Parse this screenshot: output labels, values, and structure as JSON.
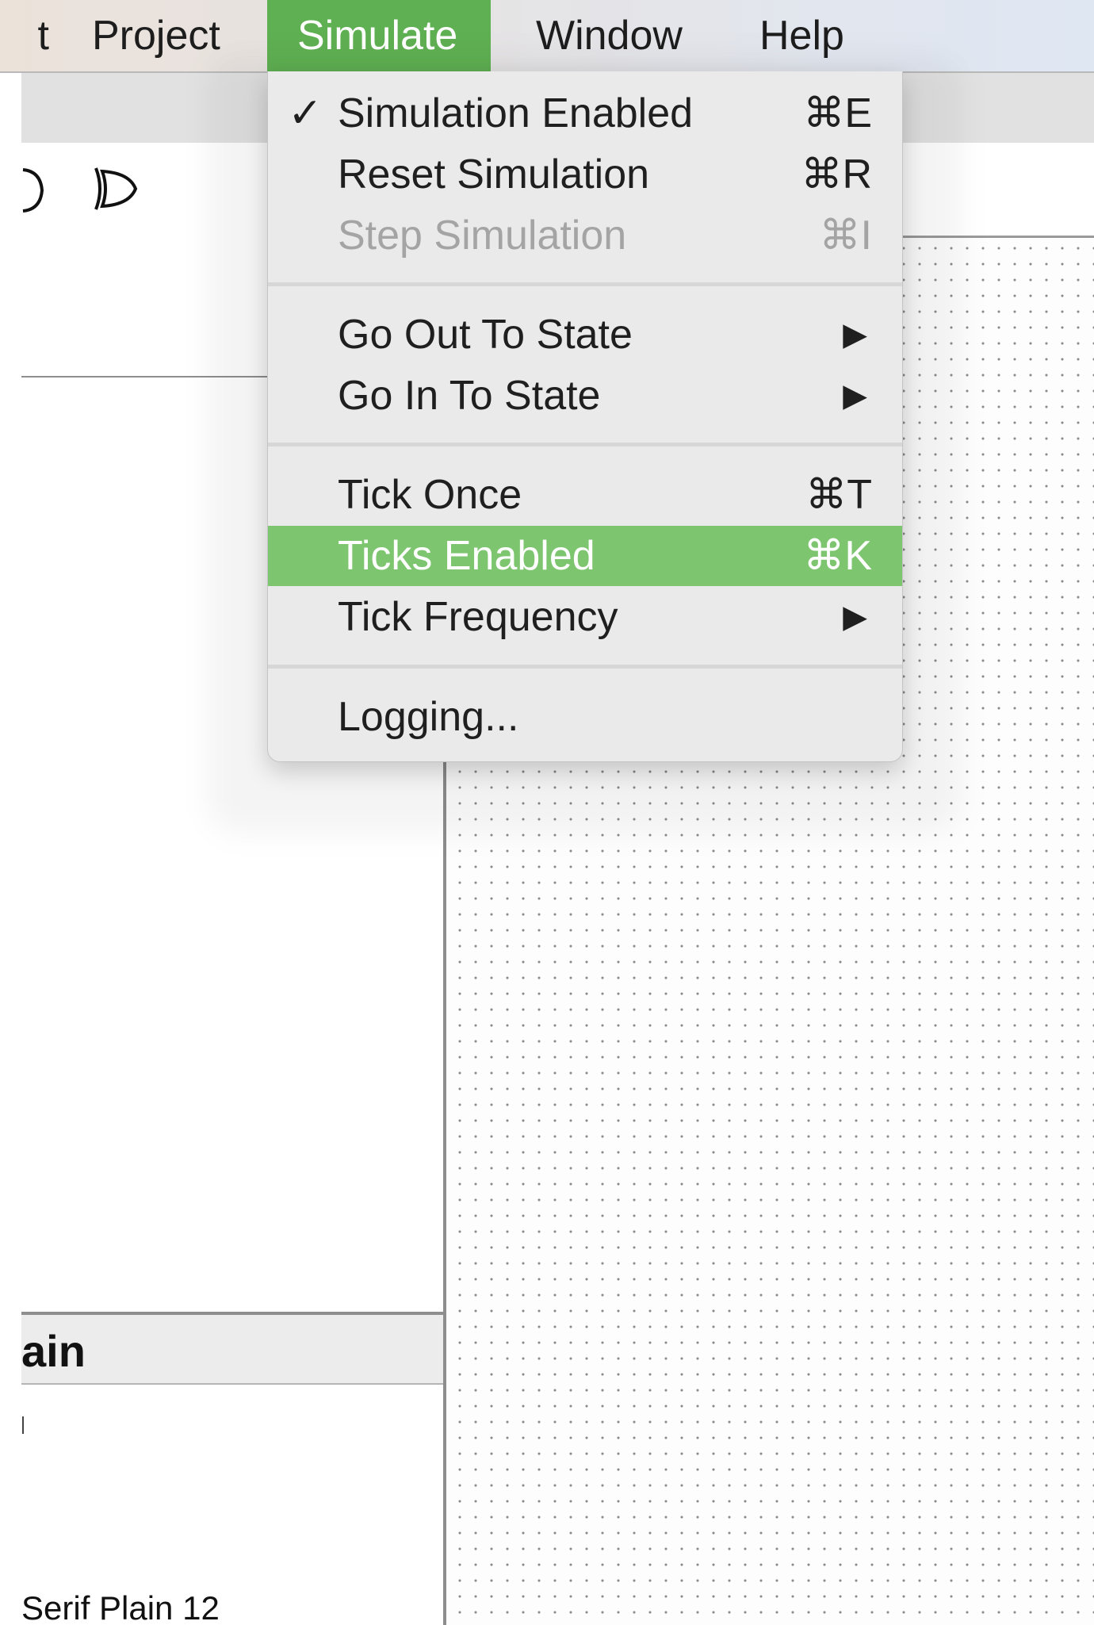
{
  "menubar": {
    "items": [
      {
        "label": "t"
      },
      {
        "label": "Project"
      },
      {
        "label": "Simulate"
      },
      {
        "label": "Window"
      },
      {
        "label": "Help"
      }
    ]
  },
  "toolbar": {
    "gates": [
      "or-gate-icon",
      "xor-gate-icon"
    ]
  },
  "simulate_menu": {
    "items": [
      {
        "label": "Simulation Enabled",
        "shortcut": "⌘E",
        "checked": true,
        "check": "✓"
      },
      {
        "label": "Reset Simulation",
        "shortcut": "⌘R"
      },
      {
        "label": "Step Simulation",
        "shortcut": "⌘I",
        "disabled": true
      },
      {
        "label": "Go Out To State",
        "submenu": "▶"
      },
      {
        "label": "Go In To State",
        "submenu": "▶"
      },
      {
        "label": "Tick Once",
        "shortcut": "⌘T"
      },
      {
        "label": "Ticks Enabled",
        "shortcut": "⌘K",
        "highlighted": true
      },
      {
        "label": "Tick Frequency",
        "submenu": "▶"
      },
      {
        "label": "Logging..."
      }
    ]
  },
  "properties": {
    "title": "ain",
    "font_value": "Serif Plain 12"
  },
  "colors": {
    "accent": "#5fb052",
    "highlight": "#7dc56f",
    "menu_bg": "#eaeaea"
  }
}
